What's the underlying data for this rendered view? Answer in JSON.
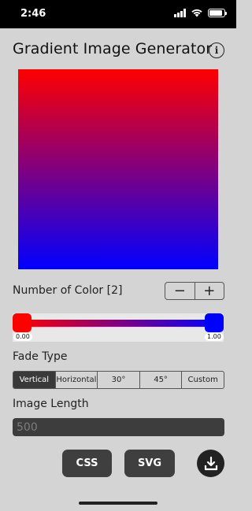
{
  "status": {
    "time": "2:46"
  },
  "app": {
    "title": "Gradient Image Generator"
  },
  "gradient": {
    "colors": [
      "#ff0000",
      "#0000ff"
    ],
    "direction": "Vertical"
  },
  "colors_section": {
    "label": "Number of Color [2]",
    "minus": "−",
    "plus": "+",
    "stops": [
      {
        "color": "#ff0000",
        "position": "0.00"
      },
      {
        "color": "#0000ff",
        "position": "1.00"
      }
    ]
  },
  "fade": {
    "label": "Fade Type",
    "options": [
      "Vertical",
      "Horizontal",
      "30°",
      "45°",
      "Custom"
    ],
    "selected": "Vertical"
  },
  "image_length": {
    "label": "Image Length",
    "placeholder": "500"
  },
  "actions": {
    "css": "CSS",
    "svg": "SVG",
    "download_icon": "download-icon"
  }
}
